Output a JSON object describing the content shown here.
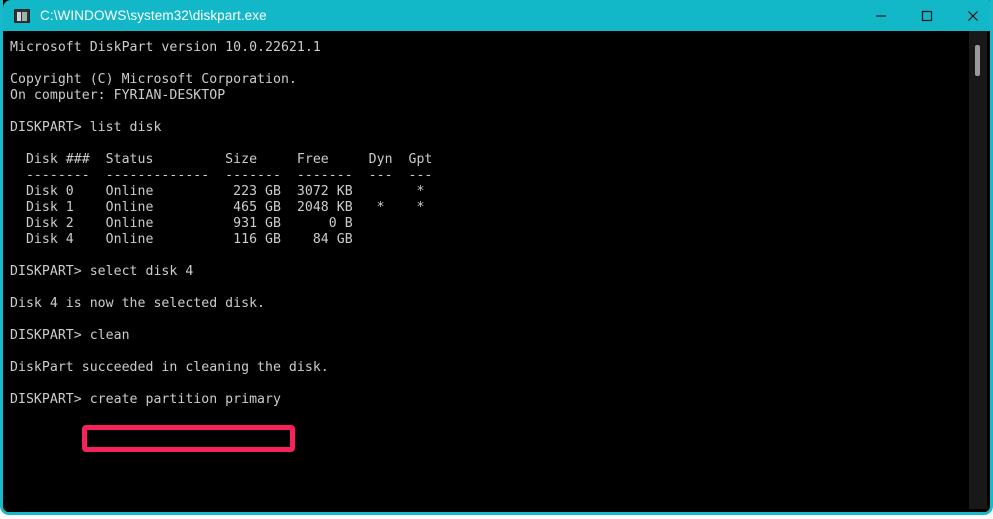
{
  "window": {
    "title": "C:\\WINDOWS\\system32\\diskpart.exe",
    "icon": "console-icon",
    "titlebar_color": "#12b8c8",
    "border_color": "#1ab8c8",
    "background_color": "#000000",
    "text_color": "#cccccc",
    "controls": {
      "minimize_label": "Minimize",
      "maximize_label": "Maximize",
      "close_label": "Close"
    }
  },
  "terminal": {
    "header": {
      "product_line": "Microsoft DiskPart version 10.0.22621.1",
      "version": "10.0.22621.1",
      "copyright": "Copyright (C) Microsoft Corporation.",
      "computer_line": "On computer: FYRIAN-DESKTOP",
      "computer_name": "FYRIAN-DESKTOP"
    },
    "prompt": "DISKPART>",
    "commands": [
      "list disk",
      "select disk 4",
      "clean",
      "create partition primary"
    ],
    "messages": [
      "Disk 4 is now the selected disk.",
      "DiskPart succeeded in cleaning the disk."
    ],
    "disk_table": {
      "headers": [
        "Disk ###",
        "Status",
        "Size",
        "Free",
        "Dyn",
        "Gpt"
      ],
      "separator": [
        "--------",
        "-------------",
        "-------",
        "-------",
        "---",
        "---"
      ],
      "rows": [
        {
          "disk": "Disk 0",
          "status": "Online",
          "size": "223 GB",
          "free": "3072 KB",
          "dyn": "",
          "gpt": "*"
        },
        {
          "disk": "Disk 1",
          "status": "Online",
          "size": "465 GB",
          "free": "2048 KB",
          "dyn": "*",
          "gpt": "*"
        },
        {
          "disk": "Disk 2",
          "status": "Online",
          "size": "931 GB",
          "free": "0 B",
          "dyn": "",
          "gpt": ""
        },
        {
          "disk": "Disk 4",
          "status": "Online",
          "size": "116 GB",
          "free": "84 GB",
          "dyn": "",
          "gpt": ""
        }
      ]
    },
    "screen_text": "Microsoft DiskPart version 10.0.22621.1\n\nCopyright (C) Microsoft Corporation.\nOn computer: FYRIAN-DESKTOP\n\nDISKPART> list disk\n\n  Disk ###  Status         Size     Free     Dyn  Gpt\n  --------  -------------  -------  -------  ---  ---\n  Disk 0    Online          223 GB  3072 KB        *\n  Disk 1    Online          465 GB  2048 KB   *    *\n  Disk 2    Online          931 GB      0 B\n  Disk 4    Online          116 GB    84 GB\n\nDISKPART> select disk 4\n\nDisk 4 is now the selected disk.\n\nDISKPART> clean\n\nDiskPart succeeded in cleaning the disk.\n\nDISKPART> create partition primary"
  },
  "annotation": {
    "highlighted_command": "create partition primary",
    "highlight_color": "#f7215c"
  },
  "scrollbar": {
    "thumb_label": "vertical-scroll-thumb",
    "track_color": "#181818",
    "thumb_color": "#9a9a9a"
  }
}
